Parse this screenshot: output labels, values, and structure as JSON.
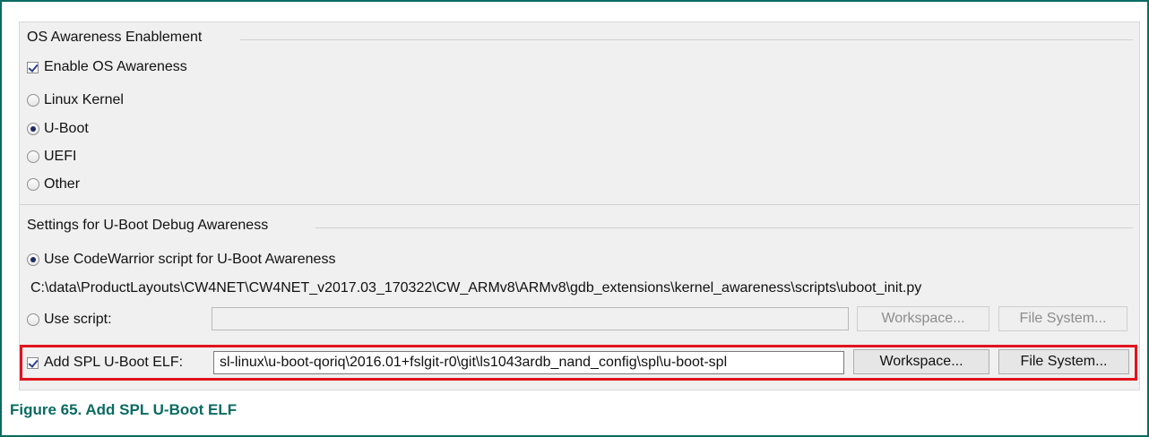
{
  "os_awareness": {
    "group_title": "OS Awareness Enablement",
    "enable_checkbox": {
      "label": "Enable OS Awareness",
      "checked": true
    },
    "options": [
      {
        "label": "Linux Kernel",
        "selected": false
      },
      {
        "label": "U-Boot",
        "selected": true
      },
      {
        "label": "UEFI",
        "selected": false
      },
      {
        "label": "Other",
        "selected": false
      }
    ]
  },
  "uboot_settings": {
    "group_title": "Settings for U-Boot Debug Awareness",
    "codewarrior_option": {
      "label": "Use CodeWarrior script for U-Boot Awareness",
      "selected": true
    },
    "codewarrior_script_path": "C:\\data\\ProductLayouts\\CW4NET\\CW4NET_v2017.03_170322\\CW_ARMv8\\ARMv8\\gdb_extensions\\kernel_awareness\\scripts\\uboot_init.py",
    "use_script": {
      "label": "Use script:",
      "selected": false,
      "value": "",
      "workspace_label": "Workspace...",
      "filesystem_label": "File System..."
    },
    "spl": {
      "label": "Add SPL U-Boot ELF:",
      "checked": true,
      "value": "sl-linux\\u-boot-qoriq\\2016.01+fslgit-r0\\git\\ls1043ardb_nand_config\\spl\\u-boot-spl",
      "workspace_label": "Workspace...",
      "filesystem_label": "File System..."
    }
  },
  "caption": "Figure 65. Add SPL U-Boot ELF",
  "colors": {
    "frame_border": "#0a6b62",
    "caption_text": "#0a6b62",
    "highlight_border": "#e0141e",
    "panel_background": "#f0f0f0"
  }
}
